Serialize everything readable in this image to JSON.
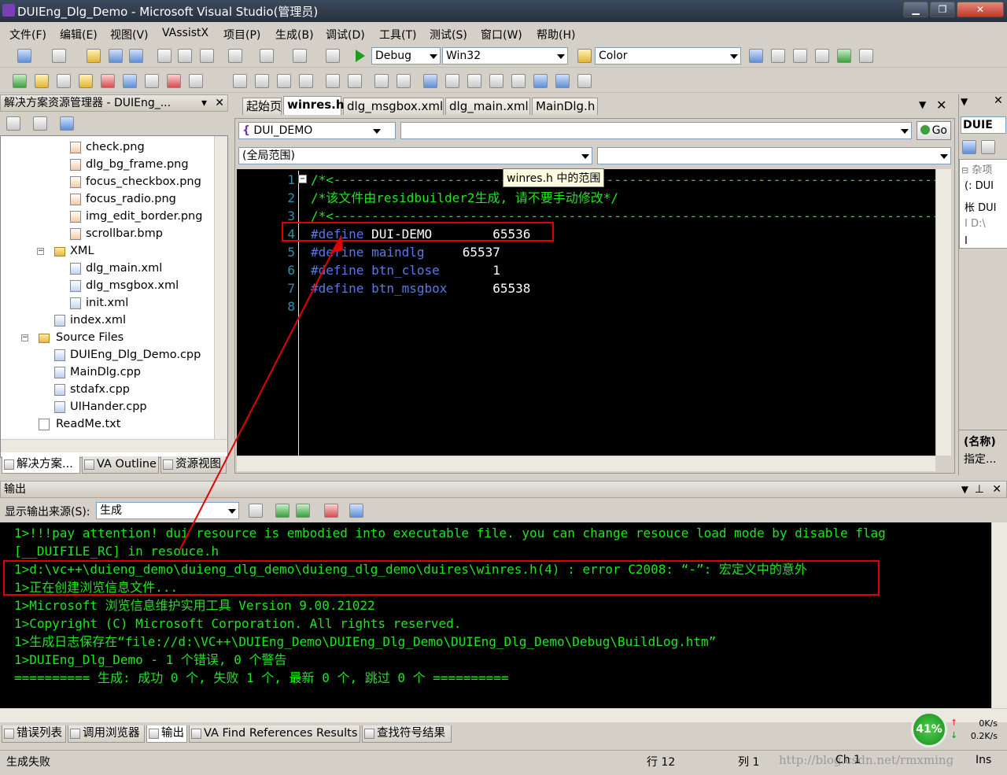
{
  "window": {
    "title": "DUIEng_Dlg_Demo - Microsoft Visual Studio(管理员)"
  },
  "menu": [
    "文件(F)",
    "编辑(E)",
    "视图(V)",
    "VAssistX",
    "项目(P)",
    "生成(B)",
    "调试(D)",
    "工具(T)",
    "测试(S)",
    "窗口(W)",
    "帮助(H)"
  ],
  "toolbar": {
    "config": "Debug",
    "platform": "Win32",
    "find": "Color"
  },
  "solution_explorer": {
    "title": "解决方案资源管理器 - DUIEng_...",
    "items": [
      "check.png",
      "dlg_bg_frame.png",
      "focus_checkbox.png",
      "focus_radio.png",
      "img_edit_border.png",
      "scrollbar.bmp",
      "XML",
      "dlg_main.xml",
      "dlg_msgbox.xml",
      "init.xml",
      "index.xml",
      "Source Files",
      "DUIEng_Dlg_Demo.cpp",
      "MainDlg.cpp",
      "stdafx.cpp",
      "UIHander.cpp",
      "ReadMe.txt"
    ],
    "tabs": [
      "解决方案...",
      "VA Outline",
      "资源视图"
    ]
  },
  "editor": {
    "tabs": [
      "起始页",
      "winres.h",
      "dlg_msgbox.xml",
      "dlg_main.xml",
      "MainDlg.h"
    ],
    "symbol_combo": "DUI_DEMO",
    "go_label": "Go",
    "scope_combo": "(全局范围)",
    "tooltip": "winres.h 中的范围",
    "lines": [
      {
        "n": "1",
        "text": "/*<-----------------------------------------------------------------------------------"
      },
      {
        "n": "2",
        "text": "/*该文件由residbuilder2生成, 请不要手动修改*/"
      },
      {
        "n": "3",
        "text": "/*<-----------------------------------------------------------------------------------"
      },
      {
        "n": "4",
        "kw": "#define",
        "name": "DUI-DEMO",
        "pad": "        ",
        "val": "65536"
      },
      {
        "n": "5",
        "kw": "#define",
        "name": "maindlg",
        "pad": "     ",
        "val": "65537"
      },
      {
        "n": "6",
        "kw": "#define",
        "name": "btn_close",
        "pad": "       ",
        "val": "1"
      },
      {
        "n": "7",
        "kw": "#define",
        "name": "btn_msgbox",
        "pad": "      ",
        "val": "65538"
      },
      {
        "n": "8",
        "text": ""
      }
    ]
  },
  "properties": {
    "combo": "DUIE",
    "category": "杂项",
    "rows": [
      "(: DUI",
      "枨 DUI",
      "I D:\\",
      "I"
    ],
    "name_label": "(名称)",
    "desc": "指定..."
  },
  "output": {
    "title": "输出",
    "source_label": "显示输出来源(S):",
    "source_value": "生成",
    "lines": [
      "1>!!!pay attention! dui resource is embodied into executable file. you can change resouce load mode by disable flag",
      "[__DUIFILE_RC] in resouce.h",
      "1>d:\\vc++\\duieng_demo\\duieng_dlg_demo\\duieng_dlg_demo\\duires\\winres.h(4) : error C2008: “-”: 宏定义中的意外",
      "1>正在创建浏览信息文件...",
      "1>Microsoft 浏览信息维护实用工具 Version 9.00.21022",
      "1>Copyright (C) Microsoft Corporation. All rights reserved.",
      "1>生成日志保存在“file://d:\\VC++\\DUIEng_Demo\\DUIEng_Dlg_Demo\\DUIEng_Dlg_Demo\\Debug\\BuildLog.htm”",
      "1>DUIEng_Dlg_Demo - 1 个错误, 0 个警告",
      "========== 生成: 成功 0 个, 失败 1 个, 最新 0 个, 跳过 0 个 =========="
    ]
  },
  "bottom_tabs": [
    "错误列表",
    "调用浏览器",
    "输出",
    "VA Find References Results",
    "查找符号结果"
  ],
  "network": {
    "percent": "41%",
    "up": "0K/s",
    "down": "0.2K/s"
  },
  "status": {
    "message": "生成失败",
    "row": "行 12",
    "col": "列 1",
    "ch": "Ch 1",
    "ins": "Ins",
    "watermark": "http://blog.csdn.net/rmxming"
  },
  "colors": {
    "keyword": "#5a78e6",
    "comment": "#1ee61e",
    "error_box": "#e00000"
  }
}
